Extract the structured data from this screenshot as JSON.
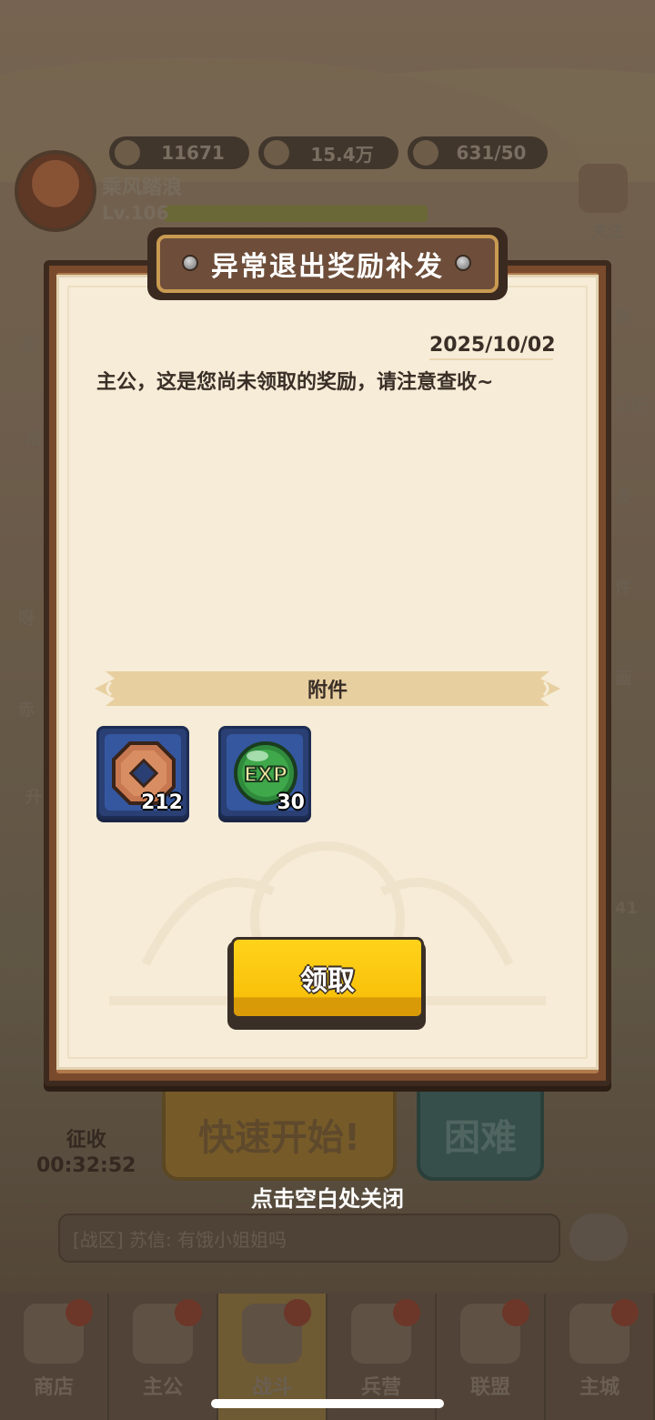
{
  "resources": [
    {
      "icon": "ingot-icon",
      "value": "11671"
    },
    {
      "icon": "copper-coin-icon",
      "value": "15.4万"
    },
    {
      "icon": "grain-icon",
      "value": "631/50"
    }
  ],
  "player": {
    "name": "乘风踏浪",
    "level": "Lv.106"
  },
  "side_right": [
    "关注",
    "务",
    "日历",
    "发",
    "件",
    "画",
    "41"
  ],
  "side_left": [
    "花",
    "浴",
    "呀",
    "赤",
    "升"
  ],
  "main_buttons": {
    "quick_start": "快速开始!",
    "hard": "困难"
  },
  "levy": {
    "label": "征收",
    "timer": "00:32:52"
  },
  "chat": {
    "text": "[战区] 苏信: 有饿小姐姐吗"
  },
  "tabs": [
    {
      "label": "商店",
      "active": false
    },
    {
      "label": "主公",
      "active": false
    },
    {
      "label": "战斗",
      "active": true
    },
    {
      "label": "兵营",
      "active": false
    },
    {
      "label": "联盟",
      "active": false
    },
    {
      "label": "主城",
      "active": false
    }
  ],
  "dialog": {
    "title": "异常退出奖励补发",
    "date": "2025/10/02",
    "message": "主公，这是您尚未领取的奖励，请注意查收~",
    "attachments_label": "附件",
    "items": [
      {
        "icon": "copper-coin-icon",
        "quantity": "212"
      },
      {
        "icon": "exp-orb-icon",
        "quantity": "30",
        "icon_text": "EXP"
      }
    ],
    "claim_label": "领取"
  },
  "close_hint": "点击空白处关闭",
  "colors": {
    "claim_yellow": "#ffd31a",
    "paper": "#f6ecd7",
    "frame_brown": "#7a4a2c",
    "item_blue": "#3557a0"
  }
}
